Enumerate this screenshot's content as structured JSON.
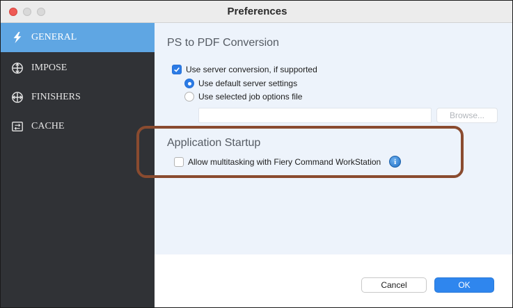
{
  "window": {
    "title": "Preferences"
  },
  "sidebar": {
    "items": [
      {
        "label": "GENERAL",
        "icon": "lightning-icon",
        "active": true
      },
      {
        "label": "IMPOSE",
        "icon": "impose-icon",
        "active": false
      },
      {
        "label": "FINISHERS",
        "icon": "finishers-icon",
        "active": false
      },
      {
        "label": "CACHE",
        "icon": "cache-icon",
        "active": false
      }
    ]
  },
  "main": {
    "conversion": {
      "title": "PS to PDF Conversion",
      "server_conversion_label": "Use server conversion, if supported",
      "server_conversion_checked": true,
      "default_settings_label": "Use default server settings",
      "default_settings_selected": true,
      "job_options_label": "Use selected job options file",
      "job_options_selected": false,
      "job_options_path": "",
      "browse_label": "Browse..."
    },
    "startup": {
      "title": "Application Startup",
      "multitask_label": "Allow multitasking with Fiery Command WorkStation",
      "multitask_checked": false,
      "info_glyph": "i"
    }
  },
  "footer": {
    "cancel_label": "Cancel",
    "ok_label": "OK"
  },
  "colors": {
    "sidebar_bg": "#303236",
    "active_item": "#5fa6e3",
    "accent": "#2f86ee",
    "highlight": "#8a4b2f"
  }
}
